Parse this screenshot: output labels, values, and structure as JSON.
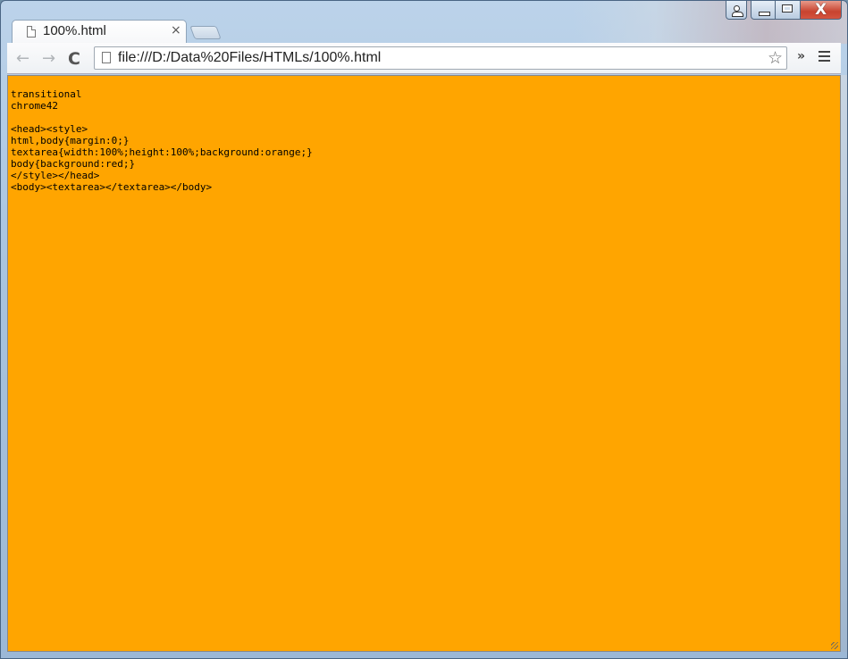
{
  "window": {
    "tab_title": "100%.html",
    "tab_close": "×",
    "controls": {
      "close_glyph": "X"
    }
  },
  "toolbar": {
    "back_glyph": "←",
    "forward_glyph": "→",
    "reload_glyph": "C",
    "url": "file:///D:/Data%20Files/HTMLs/100%.html",
    "star_glyph": "☆",
    "overflow_glyph": "»"
  },
  "page": {
    "background_color": "#ffa500",
    "text": "transitional\nchrome42\n\n<head><style>\nhtml,body{margin:0;}\ntextarea{width:100%;height:100%;background:orange;}\nbody{background:red;}\n</style></head>\n<body><textarea></textarea></body>"
  }
}
